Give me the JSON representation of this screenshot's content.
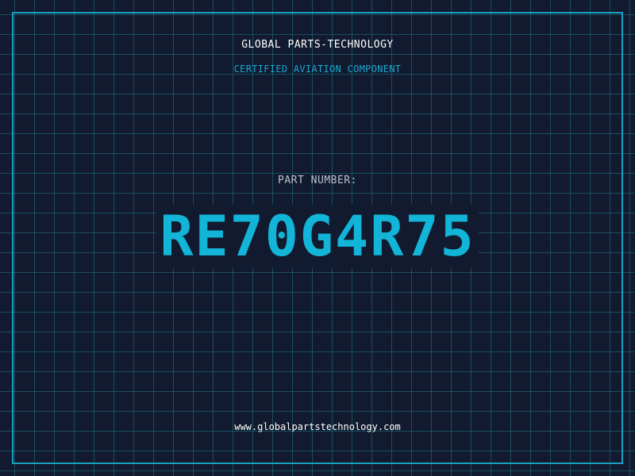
{
  "header": {
    "company_name": "GLOBAL PARTS-TECHNOLOGY",
    "tagline": "CERTIFIED AVIATION COMPONENT"
  },
  "part": {
    "label": "PART NUMBER:",
    "number": "RE70G4R75"
  },
  "footer": {
    "website": "www.globalpartstechnology.com"
  },
  "colors": {
    "background": "#111a2e",
    "grid": "#1e788c",
    "frame": "#1a9fc0",
    "accent": "#12b4d8",
    "label": "#b9c3cf",
    "text": "#ffffff"
  }
}
